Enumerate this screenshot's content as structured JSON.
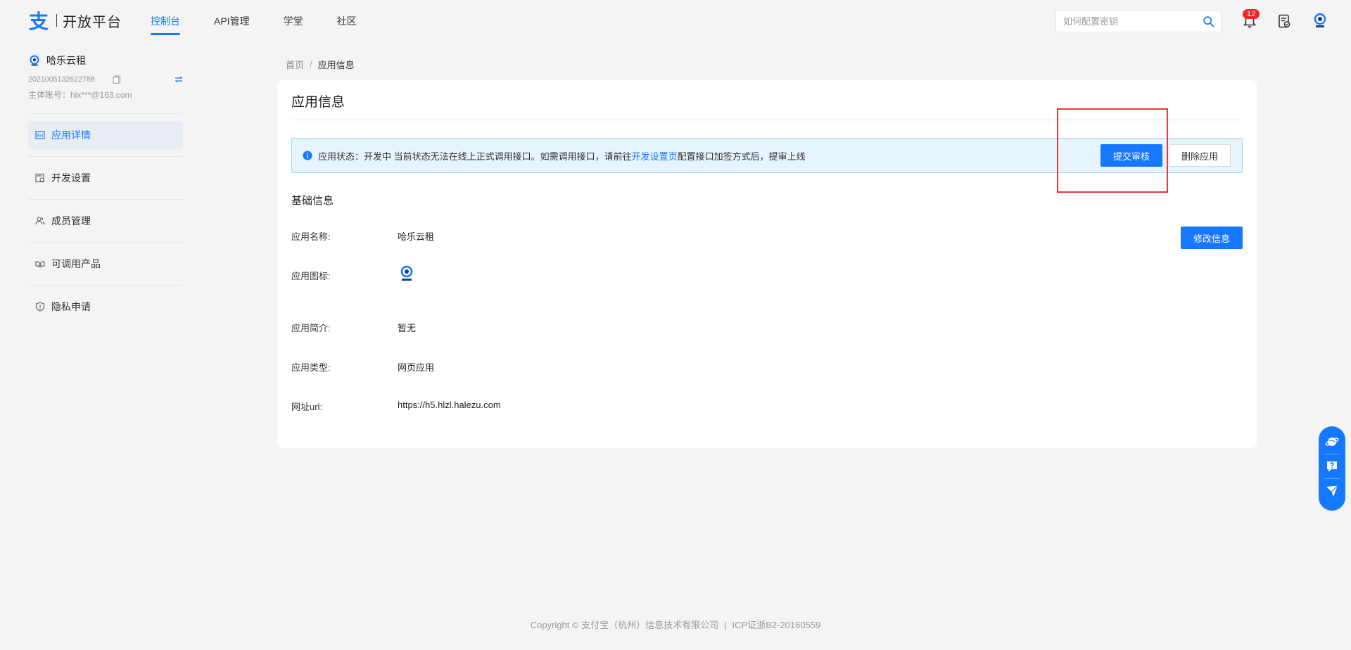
{
  "header": {
    "logo_text": "开放平台",
    "nav": [
      {
        "label": "控制台",
        "active": true
      },
      {
        "label": "API管理",
        "active": false
      },
      {
        "label": "学堂",
        "active": false
      },
      {
        "label": "社区",
        "active": false
      }
    ],
    "search_placeholder": "如何配置密钥",
    "notification_count": "12"
  },
  "sidebar": {
    "app_name": "哈乐云租",
    "app_id": "2021005132622788",
    "account": "主体账号：hlx***@163.com",
    "menu": [
      {
        "label": "应用详情",
        "icon": "app-detail-icon",
        "active": true
      },
      {
        "label": "开发设置",
        "icon": "dev-settings-icon",
        "active": false
      },
      {
        "label": "成员管理",
        "icon": "members-icon",
        "active": false
      },
      {
        "label": "可调用产品",
        "icon": "products-icon",
        "active": false
      },
      {
        "label": "隐私申请",
        "icon": "privacy-shield-icon",
        "active": false
      }
    ]
  },
  "breadcrumb": {
    "home": "首页",
    "separator": "/",
    "current": "应用信息"
  },
  "main": {
    "title": "应用信息",
    "alert": {
      "prefix": "应用状态：开发中 当前状态无法在线上正式调用接口。如需调用接口，请前往",
      "link": "开发设置页",
      "suffix": "配置接口加签方式后，提审上线"
    },
    "submit_button": "提交审核",
    "delete_button": "删除应用",
    "section_title": "基础信息",
    "edit_button": "修改信息",
    "fields": [
      {
        "label": "应用名称:",
        "value": "哈乐云租"
      },
      {
        "label": "应用图标:",
        "value": ""
      },
      {
        "label": "应用简介:",
        "value": "暂无"
      },
      {
        "label": "应用类型:",
        "value": "网页应用"
      },
      {
        "label": "网址url:",
        "value": "https://h5.hlzl.halezu.com"
      }
    ]
  },
  "footer": {
    "copyright": "Copyright © 支付宝（杭州）信息技术有限公司",
    "separator": "|",
    "icp": "ICP证浙B2-20160559"
  },
  "colors": {
    "primary": "#1677ff",
    "alert_bg": "#e6f4fd",
    "badge": "#f5222d",
    "highlight": "#e53935"
  }
}
